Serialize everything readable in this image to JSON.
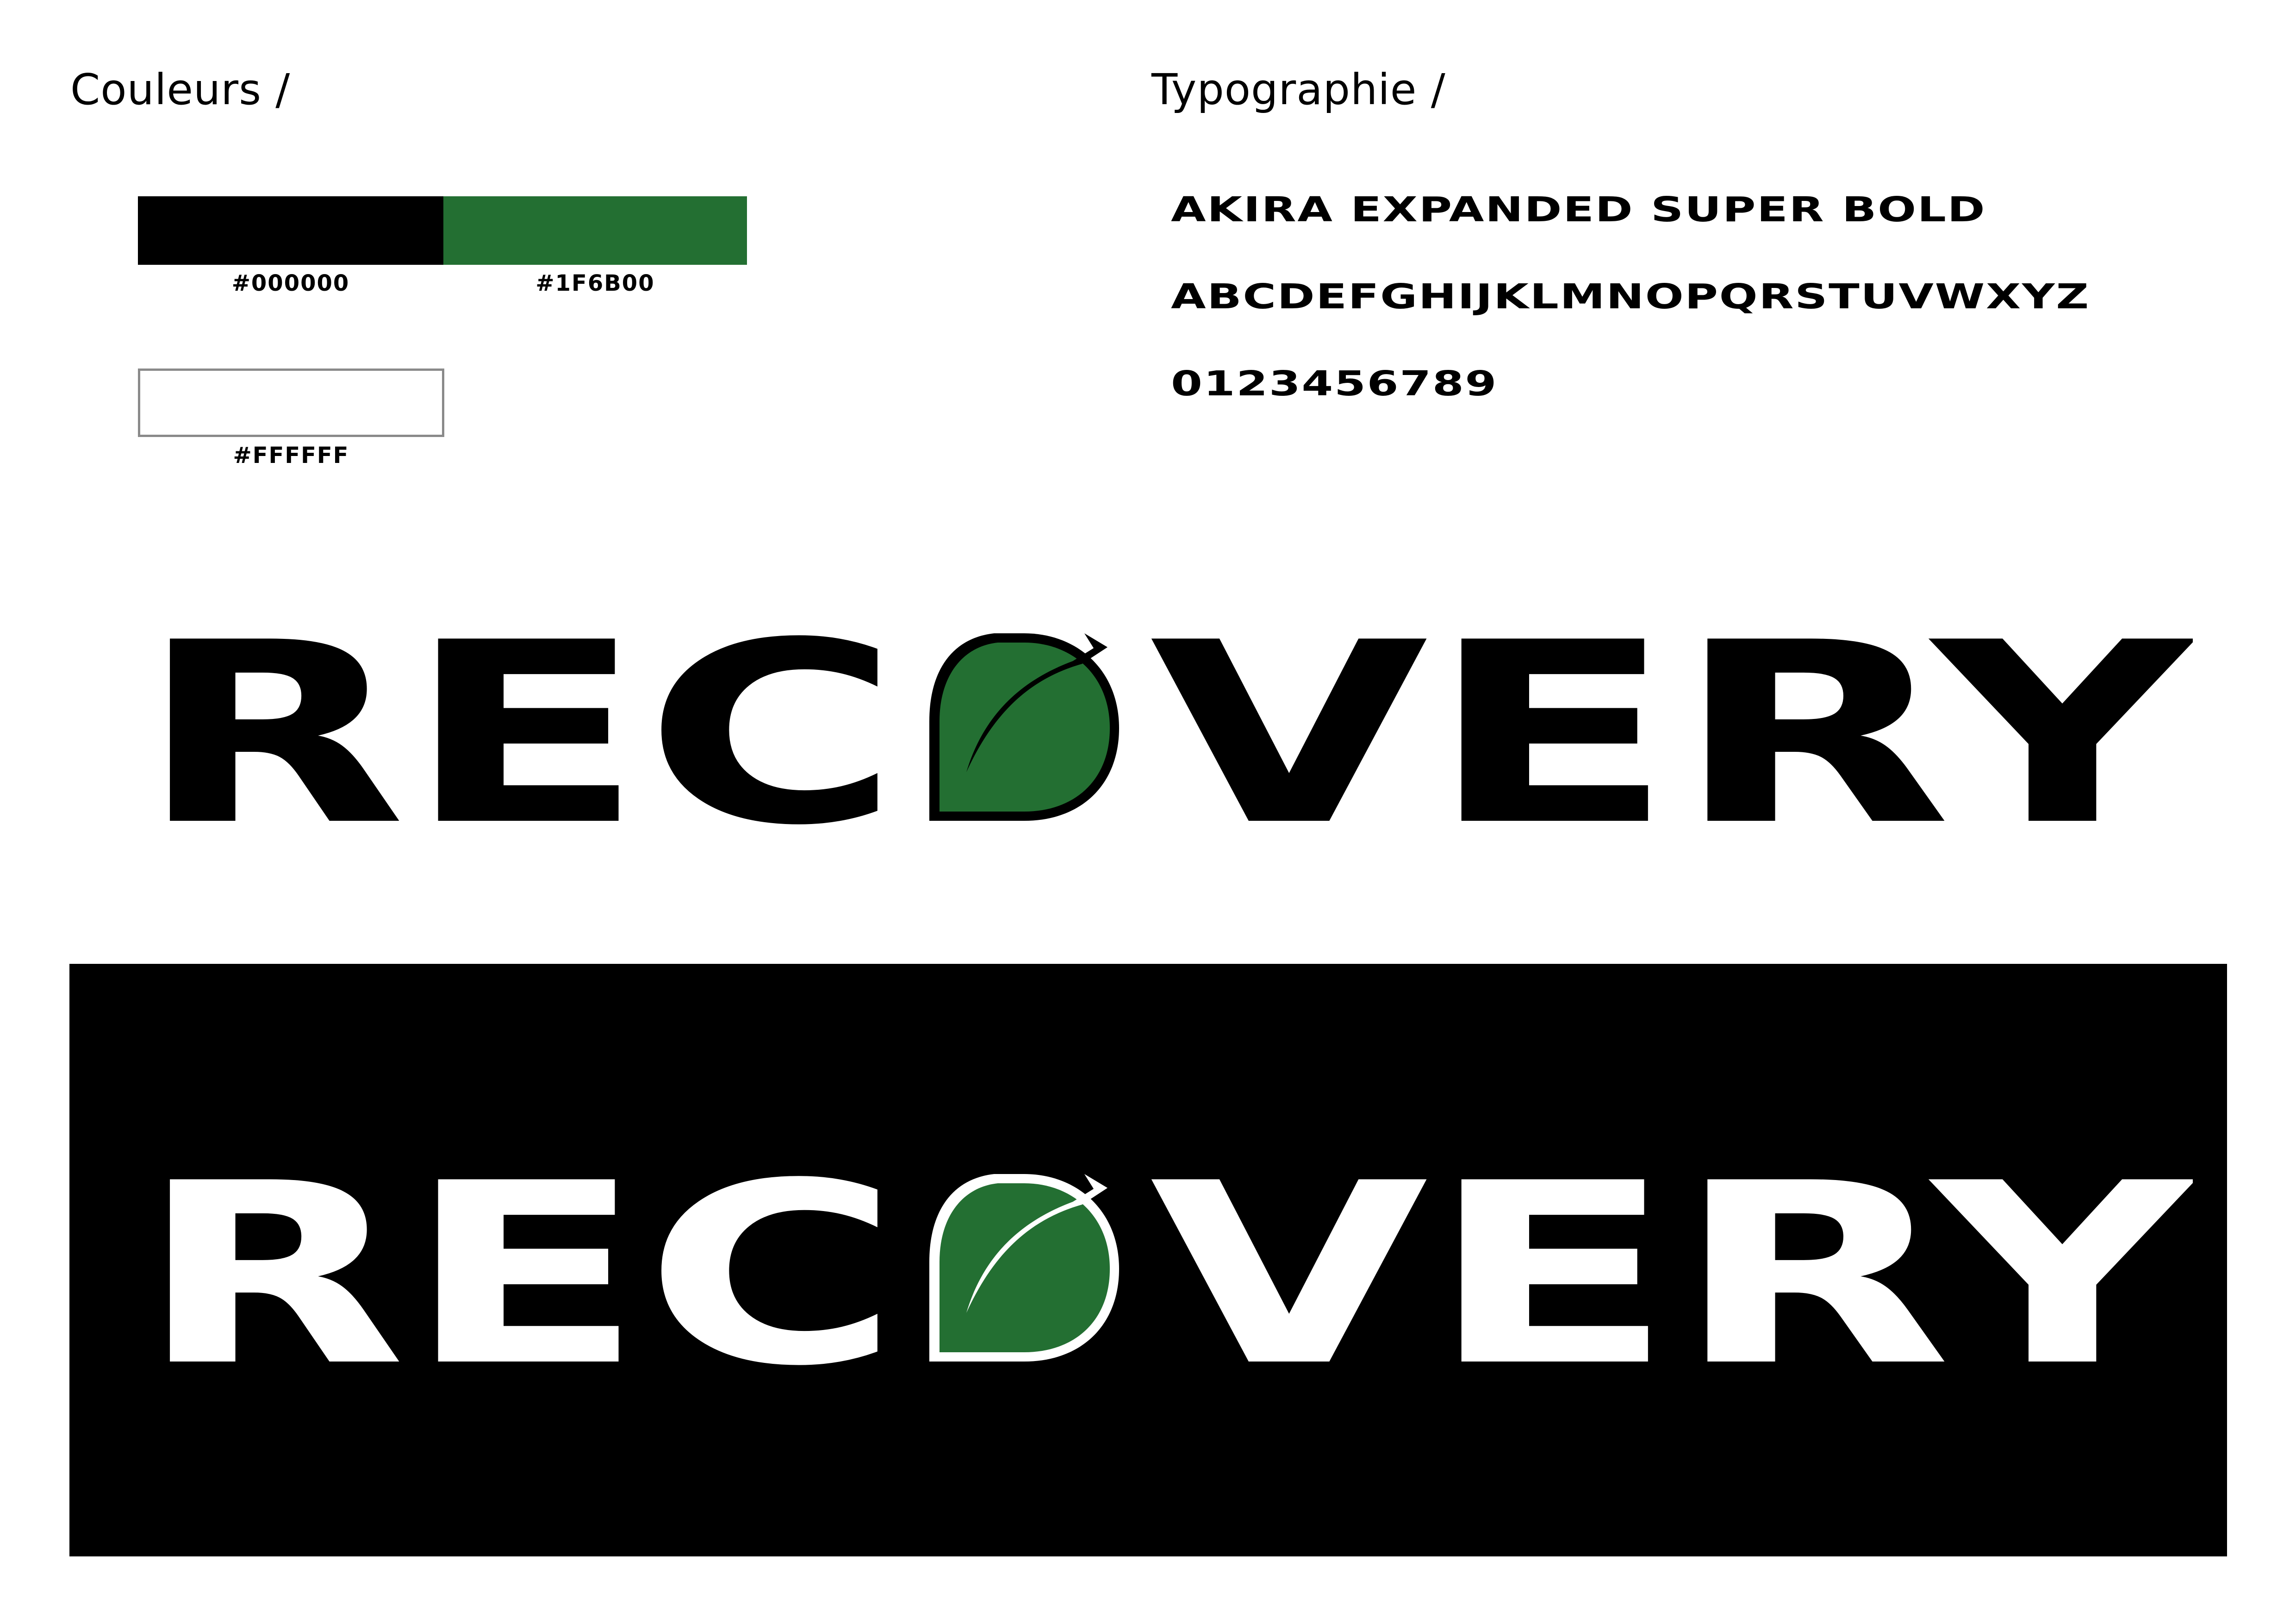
{
  "colors_section": {
    "heading": "Couleurs /",
    "swatches": [
      {
        "label": "#000000",
        "color": "#000000"
      },
      {
        "label": "#1F6B00",
        "color": "#236F32"
      },
      {
        "label": "#FFFFFF",
        "color": "#FFFFFF"
      }
    ]
  },
  "typography_section": {
    "heading": "Typographie /",
    "font_name": "AKIRA EXPANDED SUPER BOLD",
    "alphabet": "ABCDEFGHIJKLMNOPQRSTUVWXYZ",
    "digits": "0123456789"
  },
  "logo": {
    "text_left": "REC",
    "text_right": "VERY",
    "mark_icon": "leaf-icon",
    "leaf_color": "#236F32",
    "light_version": {
      "background": "#FFFFFF",
      "text_color": "#000000"
    },
    "dark_version": {
      "background": "#000000",
      "text_color": "#FFFFFF"
    }
  }
}
